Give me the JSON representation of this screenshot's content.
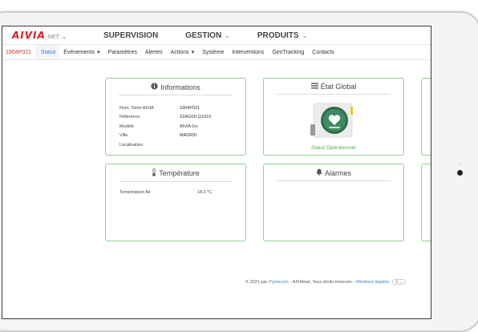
{
  "brand": {
    "logo_text": "AIVIA",
    "logo_suffix": "NET",
    "accent_color": "#d21f26",
    "link_color": "#3a7bd5"
  },
  "topmenu": [
    {
      "label": "SUPERVISION",
      "has_dropdown": false
    },
    {
      "label": "GESTION",
      "has_dropdown": true
    },
    {
      "label": "PRODUITS",
      "has_dropdown": true
    }
  ],
  "tabbar": {
    "device_id": "1904P021",
    "tabs": [
      {
        "label": "Statut",
        "active": true,
        "has_dropdown": false
      },
      {
        "label": "Événements",
        "active": false,
        "has_dropdown": true
      },
      {
        "label": "Paramètres",
        "active": false,
        "has_dropdown": false
      },
      {
        "label": "Alertes",
        "active": false,
        "has_dropdown": false
      },
      {
        "label": "Actions",
        "active": false,
        "has_dropdown": true
      },
      {
        "label": "Système",
        "active": false,
        "has_dropdown": false
      },
      {
        "label": "Interventions",
        "active": false,
        "has_dropdown": false
      },
      {
        "label": "GeoTracking",
        "active": false,
        "has_dropdown": false
      },
      {
        "label": "Contacts",
        "active": false,
        "has_dropdown": false
      }
    ]
  },
  "informations": {
    "title": "Informations",
    "icon": "info-circle-icon",
    "rows": [
      {
        "key": "Num. Série AIVIA",
        "value": "1904P021"
      },
      {
        "key": "Référence",
        "value": "X2AG00-Q1010"
      },
      {
        "key": "Modèle",
        "value": "AIVIA Go"
      },
      {
        "key": "Ville",
        "value": "MADRID"
      },
      {
        "key": "Localisation",
        "value": ""
      }
    ]
  },
  "etat_global": {
    "title": "État Global",
    "icon": "list-icon",
    "status_label": "Statut Opérationnel",
    "status_color": "#4caf50"
  },
  "temperature": {
    "title": "Température",
    "icon": "thermometer-icon",
    "rows": [
      {
        "key": "Température Air",
        "value": "18.0 °C"
      }
    ]
  },
  "alarmes": {
    "title": "Alarmes",
    "icon": "bell-icon"
  },
  "footer": {
    "prefix": "© 2021 par",
    "company": "Pyrescom",
    "middle": "- AIVIAnet. Tous droits réservés -",
    "legal_link": "Mentions légales",
    "lang": "fr"
  }
}
